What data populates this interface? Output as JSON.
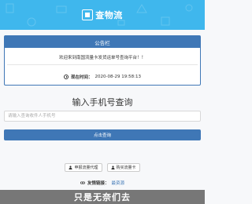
{
  "header": {
    "logo_text": "查物流",
    "bg_color": "#3fb7ed"
  },
  "notice": {
    "title": "公告栏",
    "welcome": "欢迎来到南国流量卡发货运单号查询平台！！",
    "time_label": "现在时间：",
    "time_value": "2020-08-29 19:58:13"
  },
  "query": {
    "title": "输入手机号查询",
    "placeholder": "请输入查询收件人手机号",
    "button_label": "点击查询"
  },
  "actions": {
    "agent_label": "申报流量代理",
    "buy_label": "购买流量卡"
  },
  "links": {
    "label": "友情链接：",
    "link_text": "最资源"
  },
  "footer": {
    "text": "只是无奈们去"
  },
  "colors": {
    "primary": "#3f77b6",
    "header": "#3fb7ed",
    "footer": "#777777"
  }
}
